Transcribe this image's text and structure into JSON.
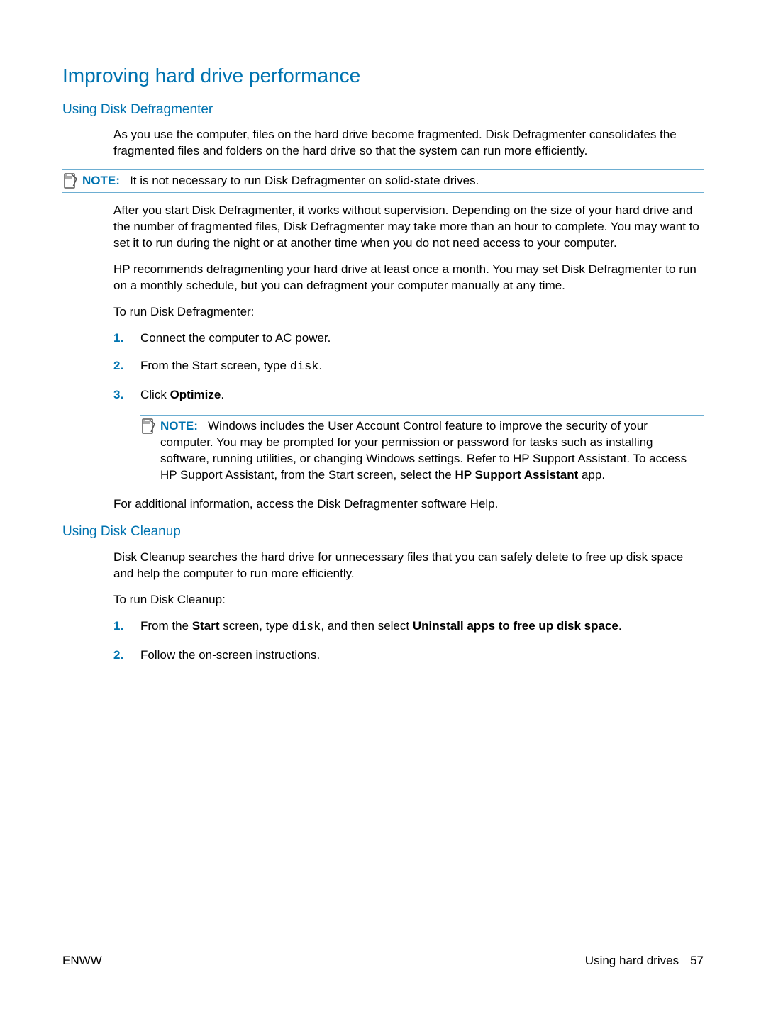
{
  "h1": "Improving hard drive performance",
  "section1": {
    "heading": "Using Disk Defragmenter",
    "p1": "As you use the computer, files on the hard drive become fragmented. Disk Defragmenter consolidates the fragmented files and folders on the hard drive so that the system can run more efficiently.",
    "note1": {
      "label": "NOTE:",
      "text": "It is not necessary to run Disk Defragmenter on solid-state drives."
    },
    "p2": "After you start Disk Defragmenter, it works without supervision. Depending on the size of your hard drive and the number of fragmented files, Disk Defragmenter may take more than an hour to complete. You may want to set it to run during the night or at another time when you do not need access to your computer.",
    "p3": "HP recommends defragmenting your hard drive at least once a month. You may set Disk Defragmenter to run on a monthly schedule, but you can defragment your computer manually at any time.",
    "p4": "To run Disk Defragmenter:",
    "steps": {
      "s1": "Connect the computer to AC power.",
      "s2_pre": "From the Start screen, type ",
      "s2_mono": "disk",
      "s2_post": ".",
      "s3_pre": "Click ",
      "s3_bold": "Optimize",
      "s3_post": "."
    },
    "note2": {
      "label": "NOTE:",
      "text_pre": "Windows includes the User Account Control feature to improve the security of your computer. You may be prompted for your permission or password for tasks such as installing software, running utilities, or changing Windows settings. Refer to HP Support Assistant. To access HP Support Assistant, from the Start screen, select the ",
      "text_bold": "HP Support Assistant",
      "text_post": " app."
    },
    "p5": "For additional information, access the Disk Defragmenter software Help."
  },
  "section2": {
    "heading": "Using Disk Cleanup",
    "p1": "Disk Cleanup searches the hard drive for unnecessary files that you can safely delete to free up disk space and help the computer to run more efficiently.",
    "p2": "To run Disk Cleanup:",
    "steps": {
      "s1_pre": "From the ",
      "s1_b1": "Start",
      "s1_mid1": " screen, type ",
      "s1_mono": "disk",
      "s1_mid2": ", and then select ",
      "s1_b2": "Uninstall apps to free up disk space",
      "s1_post": ".",
      "s2": "Follow the on-screen instructions."
    }
  },
  "footer": {
    "left": "ENWW",
    "rightText": "Using hard drives",
    "pageNum": "57"
  }
}
